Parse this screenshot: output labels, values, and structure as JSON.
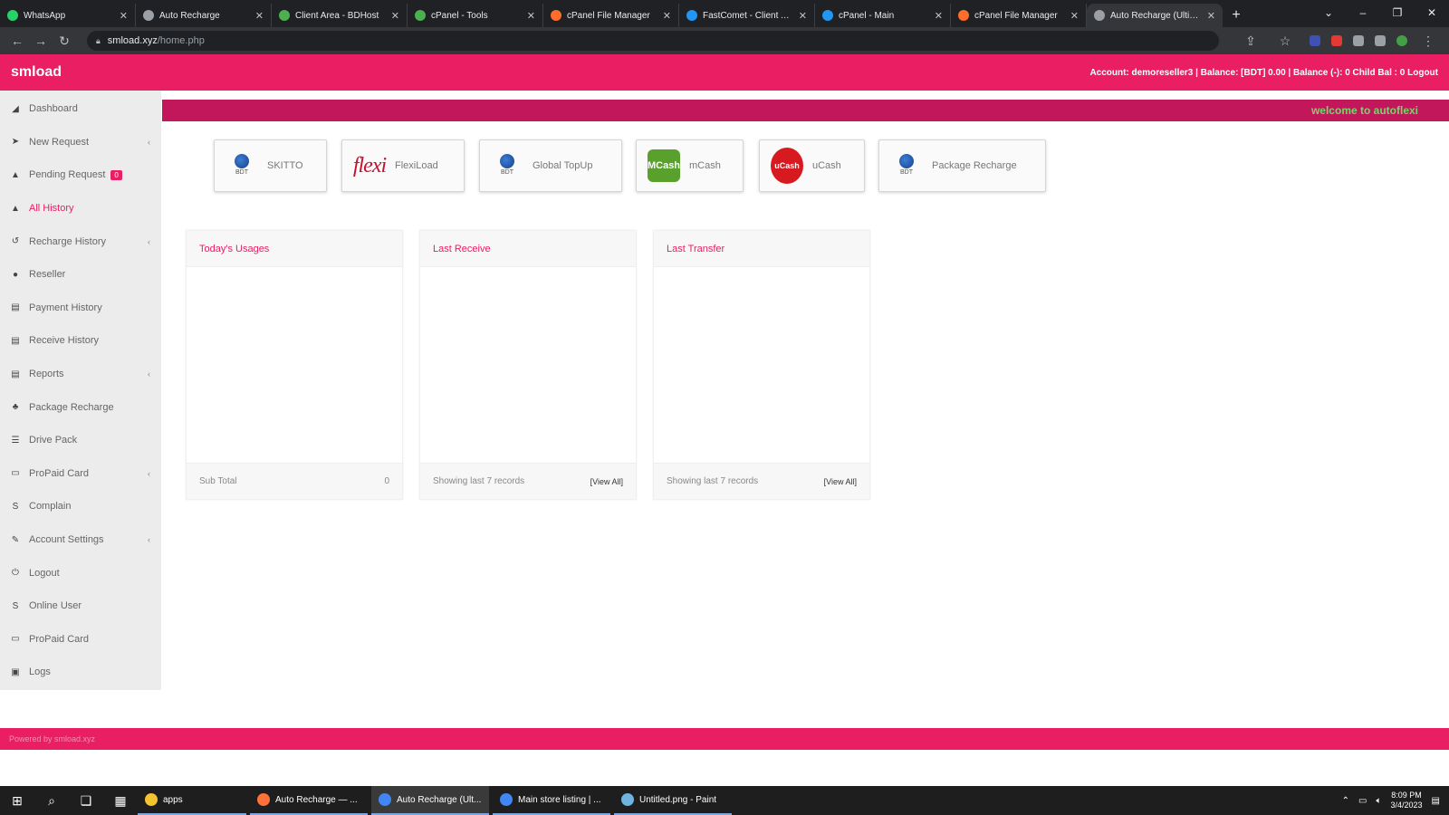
{
  "browser": {
    "tabs": [
      {
        "label": "WhatsApp",
        "color": "#25d366",
        "active": false
      },
      {
        "label": "Auto Recharge",
        "color": "#9aa0a6",
        "active": false
      },
      {
        "label": "Client Area - BDHost",
        "color": "#4caf50",
        "active": false
      },
      {
        "label": "cPanel - Tools",
        "color": "#4caf50",
        "active": false
      },
      {
        "label": "cPanel File Manager",
        "color": "#ff6c2c",
        "active": false
      },
      {
        "label": "FastComet - Client Area",
        "color": "#2196f3",
        "active": false
      },
      {
        "label": "cPanel - Main",
        "color": "#2196f3",
        "active": false
      },
      {
        "label": "cPanel File Manager",
        "color": "#ff6c2c",
        "active": false
      },
      {
        "label": "Auto Recharge (Ultimate)",
        "color": "#9aa0a6",
        "active": true
      }
    ],
    "url_host": "smload.xyz",
    "url_path": "/home.php"
  },
  "header": {
    "brand": "smload",
    "account_info": "Account: demoreseller3 | Balance: [BDT] 0.00 | Balance (-): 0    Child Bal : 0 Logout"
  },
  "sidebar": {
    "items": [
      {
        "label": "Dashboard",
        "icon": "dashboard-icon",
        "glyph": "◢",
        "chevron": false,
        "active": false
      },
      {
        "label": "New Request",
        "icon": "cursor-icon",
        "glyph": "➤",
        "chevron": true,
        "active": false
      },
      {
        "label": "Pending Request",
        "icon": "user-icon",
        "glyph": "▲",
        "chevron": false,
        "active": false,
        "badge": "0"
      },
      {
        "label": "All History",
        "icon": "user-icon",
        "glyph": "▲",
        "chevron": false,
        "active": true
      },
      {
        "label": "Recharge History",
        "icon": "history-icon",
        "glyph": "↺",
        "chevron": true,
        "active": false
      },
      {
        "label": "Reseller",
        "icon": "person-icon",
        "glyph": "●",
        "chevron": false,
        "active": false
      },
      {
        "label": "Payment History",
        "icon": "table-icon",
        "glyph": "▤",
        "chevron": false,
        "active": false
      },
      {
        "label": "Receive History",
        "icon": "table-icon",
        "glyph": "▤",
        "chevron": false,
        "active": false
      },
      {
        "label": "Reports",
        "icon": "table-icon",
        "glyph": "▤",
        "chevron": true,
        "active": false
      },
      {
        "label": "Package Recharge",
        "icon": "users-icon",
        "glyph": "♣",
        "chevron": false,
        "active": false
      },
      {
        "label": "Drive Pack",
        "icon": "stack-icon",
        "glyph": "☰",
        "chevron": false,
        "active": false
      },
      {
        "label": "ProPaid Card",
        "icon": "card-icon",
        "glyph": "▭",
        "chevron": true,
        "active": false
      },
      {
        "label": "Complain",
        "icon": "skype-icon",
        "glyph": "S",
        "chevron": false,
        "active": false
      },
      {
        "label": "Account Settings",
        "icon": "wrench-icon",
        "glyph": "✎",
        "chevron": true,
        "active": false
      },
      {
        "label": "Logout",
        "icon": "power-icon",
        "glyph": "⏻",
        "chevron": false,
        "active": false
      },
      {
        "label": "Online User",
        "icon": "skype-icon",
        "glyph": "S",
        "chevron": false,
        "active": false
      },
      {
        "label": "ProPaid Card",
        "icon": "card-icon",
        "glyph": "▭",
        "chevron": false,
        "active": false
      },
      {
        "label": "Logs",
        "icon": "log-icon",
        "glyph": "▣",
        "chevron": false,
        "active": false
      }
    ]
  },
  "welcome": "welcome to autoflexi",
  "services": [
    {
      "label": "SKITTO",
      "logo": "globe",
      "logo_text": "BDT"
    },
    {
      "label": "FlexiLoad",
      "logo": "flexi",
      "logo_text": "flexi"
    },
    {
      "label": "Global TopUp",
      "logo": "globe",
      "logo_text": "BDT"
    },
    {
      "label": "mCash",
      "logo": "mcash",
      "logo_text": "MCash"
    },
    {
      "label": "uCash",
      "logo": "ucash",
      "logo_text": "uCash"
    },
    {
      "label": "Package Recharge",
      "logo": "globe",
      "logo_text": "BDT"
    }
  ],
  "panels": [
    {
      "title": "Today's Usages",
      "footer_left": "Sub Total",
      "footer_right": "0"
    },
    {
      "title": "Last Receive",
      "footer_left": "Showing last 7 records",
      "footer_right": "[View All]"
    },
    {
      "title": "Last Transfer",
      "footer_left": "Showing last 7 records",
      "footer_right": "[View All]"
    }
  ],
  "footer": "Powered by smload.xyz",
  "taskbar": {
    "apps": [
      {
        "label": "apps",
        "color": "#f4c430",
        "active": false
      },
      {
        "label": "Auto Recharge — ...",
        "color": "#ff7139",
        "active": false
      },
      {
        "label": "Auto Recharge (Ult...",
        "color": "#4285f4",
        "active": true
      },
      {
        "label": "Main store listing | ...",
        "color": "#4285f4",
        "active": false
      },
      {
        "label": "Untitled.png - Paint",
        "color": "#6fb3e0",
        "active": false
      }
    ],
    "time": "8:09 PM",
    "date": "3/4/2023"
  },
  "colors": {
    "brand": "#e91e63",
    "welcome_strip": "#c2185b",
    "welcome_text": "#7bd36b"
  }
}
